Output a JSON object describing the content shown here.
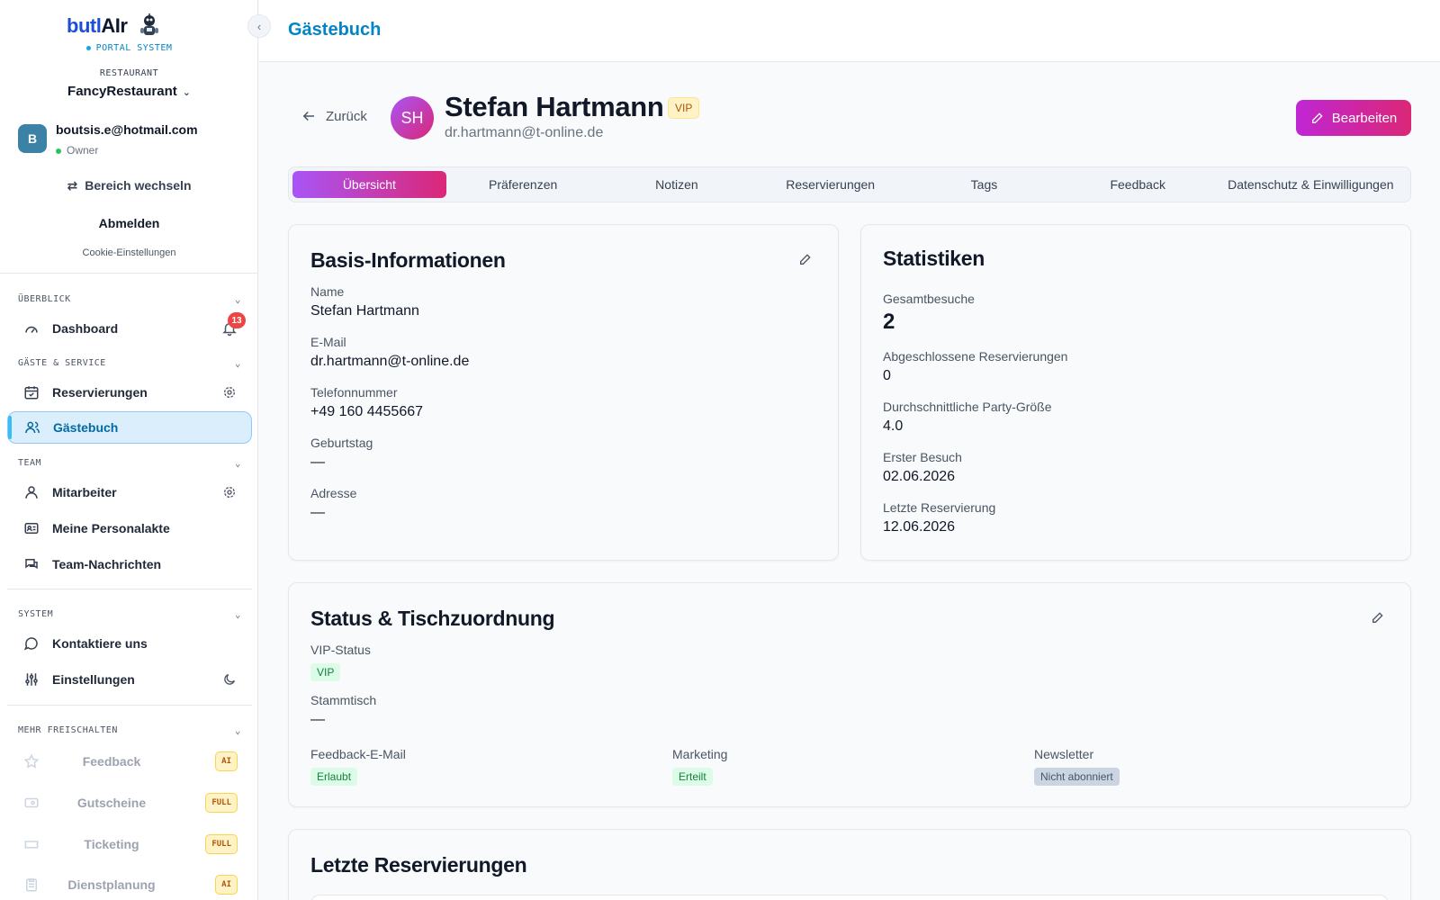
{
  "sidebar": {
    "brand": {
      "name_main": "butl",
      "name_ai": "AIr",
      "portal": "PORTAL SYSTEM"
    },
    "restaurant": {
      "label": "RESTAURANT",
      "name": "FancyRestaurant"
    },
    "user": {
      "initial": "B",
      "email": "boutsis.e@hotmail.com",
      "role": "Owner"
    },
    "switch_label": "Bereich wechseln",
    "logout_label": "Abmelden",
    "cookie_label": "Cookie-Einstellungen",
    "sections": {
      "overview": "ÜBERBLICK",
      "guests": "GÄSTE & SERVICE",
      "team": "TEAM",
      "system": "SYSTEM",
      "more": "MEHR FREISCHALTEN"
    },
    "items": {
      "dashboard": "Dashboard",
      "notifications": "13",
      "reservations": "Reservierungen",
      "guestbook": "Gästebuch",
      "staff": "Mitarbeiter",
      "personnel": "Meine Personalakte",
      "team_messages": "Team-Nachrichten",
      "contact": "Kontaktiere uns",
      "settings": "Einstellungen"
    },
    "locked": [
      {
        "label": "Feedback",
        "tier": "AI"
      },
      {
        "label": "Gutscheine",
        "tier": "FULL"
      },
      {
        "label": "Ticketing",
        "tier": "FULL"
      },
      {
        "label": "Dienstplanung",
        "tier": "AI"
      }
    ]
  },
  "header": {
    "title": "Gästebuch"
  },
  "guest": {
    "back_label": "Zurück",
    "initials": "SH",
    "name": "Stefan Hartmann",
    "vip_badge": "VIP",
    "email": "dr.hartmann@t-online.de",
    "edit_label": "Bearbeiten"
  },
  "tabs": [
    "Übersicht",
    "Präferenzen",
    "Notizen",
    "Reservierungen",
    "Tags",
    "Feedback",
    "Datenschutz & Einwilligungen"
  ],
  "basic_info": {
    "title": "Basis-Informationen",
    "fields": [
      {
        "label": "Name",
        "value": "Stefan Hartmann"
      },
      {
        "label": "E-Mail",
        "value": "dr.hartmann@t-online.de"
      },
      {
        "label": "Telefonnummer",
        "value": "+49 160 4455667"
      },
      {
        "label": "Geburtstag",
        "value": "—"
      },
      {
        "label": "Adresse",
        "value": "—"
      }
    ]
  },
  "stats": {
    "title": "Statistiken",
    "fields": [
      {
        "label": "Gesamtbesuche",
        "value": "2"
      },
      {
        "label": "Abgeschlossene Reservierungen",
        "value": "0"
      },
      {
        "label": "Durchschnittliche Party-Größe",
        "value": "4.0"
      },
      {
        "label": "Erster Besuch",
        "value": "02.06.2026"
      },
      {
        "label": "Letzte Reservierung",
        "value": "12.06.2026"
      }
    ]
  },
  "status": {
    "title": "Status & Tischzuordnung",
    "vip_label": "VIP-Status",
    "vip_value": "VIP",
    "table_label": "Stammtisch",
    "table_value": "—",
    "feedback_label": "Feedback-E-Mail",
    "feedback_value": "Erlaubt",
    "marketing_label": "Marketing",
    "marketing_value": "Erteilt",
    "newsletter_label": "Newsletter",
    "newsletter_value": "Nicht abonniert"
  },
  "recent": {
    "title": "Letzte Reservierungen"
  }
}
